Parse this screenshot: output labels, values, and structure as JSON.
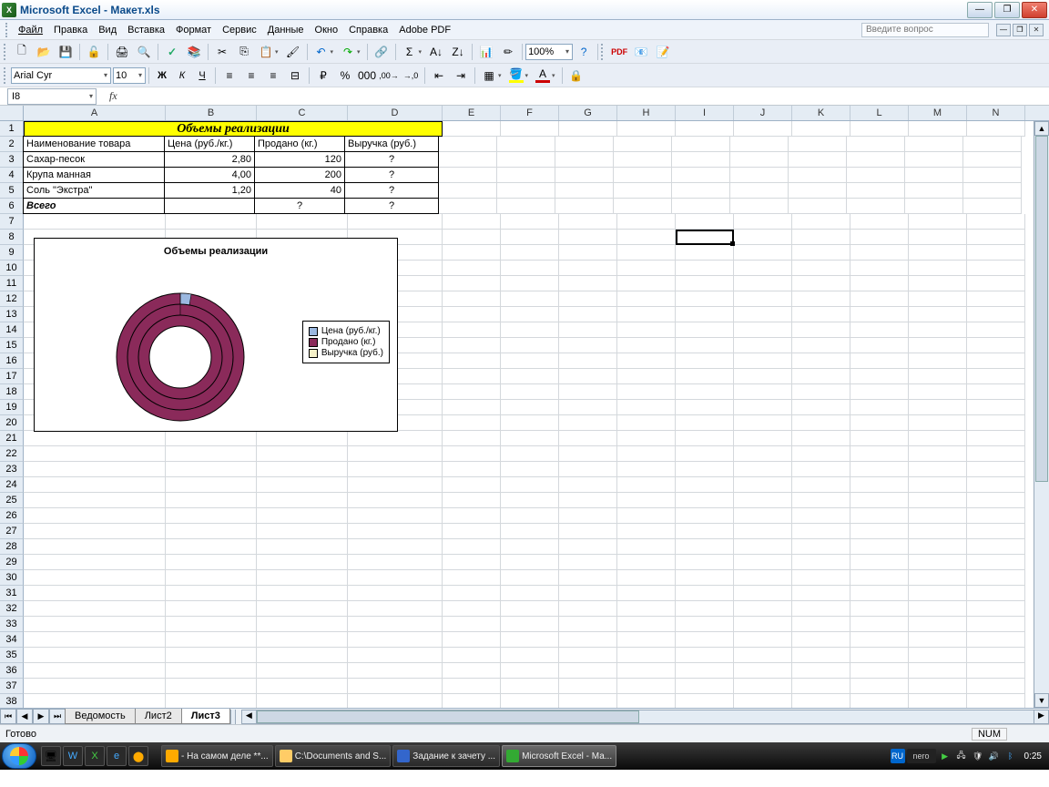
{
  "window": {
    "title": "Microsoft Excel - Макет.xls"
  },
  "menu": {
    "file": "Файл",
    "edit": "Правка",
    "view": "Вид",
    "insert": "Вставка",
    "format": "Формат",
    "tools": "Сервис",
    "data": "Данные",
    "window": "Окно",
    "help": "Справка",
    "adobe": "Adobe PDF",
    "question_ph": "Введите вопрос"
  },
  "formatbar": {
    "font": "Arial Cyr",
    "size": "10",
    "zoom": "100%"
  },
  "namebox": "I8",
  "columns": [
    "A",
    "B",
    "C",
    "D",
    "E",
    "F",
    "G",
    "H",
    "I",
    "J",
    "K",
    "L",
    "M",
    "N"
  ],
  "row_numbers": [
    1,
    2,
    3,
    4,
    5,
    6,
    7,
    8,
    9,
    10,
    11,
    12,
    13,
    14,
    15,
    16,
    17,
    18,
    19,
    20,
    21,
    22,
    23,
    24,
    25,
    26,
    27,
    28,
    29,
    30,
    31,
    32,
    33,
    34,
    35,
    36,
    37,
    38
  ],
  "table": {
    "title": "Объемы реализации",
    "headers": {
      "name": "Наименование товара",
      "price": "Цена (руб./кг.)",
      "sold": "Продано (кг.)",
      "rev": "Выручка (руб.)"
    },
    "rows": [
      {
        "name": "Сахар-песок",
        "price": "2,80",
        "sold": "120",
        "rev": "?"
      },
      {
        "name": "Крупа манная",
        "price": "4,00",
        "sold": "200",
        "rev": "?"
      },
      {
        "name": "Соль \"Экстра\"",
        "price": "1,20",
        "sold": "40",
        "rev": "?"
      }
    ],
    "total_label": "Всего",
    "total_sold": "?",
    "total_rev": "?"
  },
  "chart_data": {
    "type": "pie",
    "title": "Объемы реализации",
    "categories": [
      "Сахар-песок",
      "Крупа манная",
      "Соль \"Экстра\""
    ],
    "series": [
      {
        "name": "Цена (руб./кг.)",
        "values": [
          2.8,
          4.0,
          1.2
        ]
      },
      {
        "name": "Продано (кг.)",
        "values": [
          120,
          200,
          40
        ]
      },
      {
        "name": "Выручка (руб.)",
        "values": [
          null,
          null,
          null
        ]
      }
    ],
    "legend": [
      "Цена (руб./кг.)",
      "Продано (кг.)",
      "Выручка (руб.)"
    ],
    "colors": {
      "price": "#9bb8e0",
      "sold": "#8a2a5a",
      "rev": "#f5f0c8"
    }
  },
  "sheets": {
    "s1": "Ведомость",
    "s2": "Лист2",
    "s3": "Лист3"
  },
  "status": {
    "ready": "Готово",
    "num": "NUM"
  },
  "taskbar": {
    "t1": "- На самом деле **...",
    "t2": "C:\\Documents and S...",
    "t3": "Задание к зачету ...",
    "t4": "Microsoft Excel - Ма...",
    "lang": "RU",
    "nero": "nero",
    "clock": "0:25"
  }
}
